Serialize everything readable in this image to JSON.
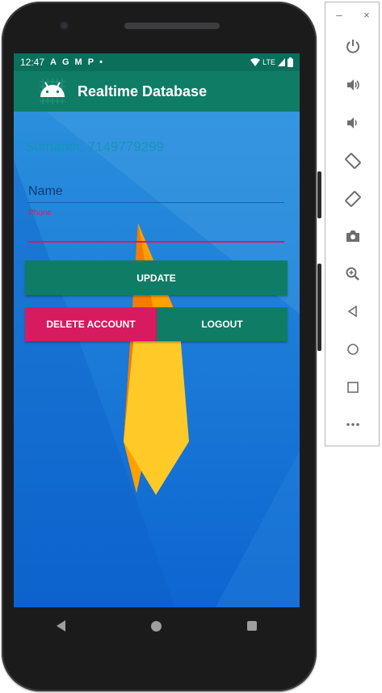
{
  "statusbar": {
    "time": "12:47",
    "icons": [
      "A",
      "G",
      "M",
      "P",
      "•"
    ],
    "network": "LTE"
  },
  "appbar": {
    "title": "Realtime Database",
    "logo_icon": "android-icon"
  },
  "main": {
    "user_info": "Sumanth, 7149779299",
    "name_placeholder": "Name",
    "phone_label": "Phone",
    "phone_value": "",
    "update_label": "UPDATE",
    "delete_label": "DELETE ACCOUNT",
    "logout_label": "LOGOUT"
  },
  "navbar": {
    "icons": [
      "back-icon",
      "home-icon",
      "recents-icon"
    ]
  },
  "emulator_panel": {
    "window_controls": [
      "–",
      "×"
    ],
    "tools": [
      "power-icon",
      "volume-up-icon",
      "volume-down-icon",
      "rotate-left-icon",
      "rotate-right-icon",
      "camera-icon",
      "zoom-icon",
      "back-icon",
      "home-icon",
      "overview-icon",
      "more-icon"
    ]
  },
  "colors": {
    "status_bar": "#0a6f5b",
    "app_bar": "#0f7d66",
    "accent": "#d81b60",
    "background": "#1c76d8",
    "firebase_flame": "#ffca28"
  }
}
